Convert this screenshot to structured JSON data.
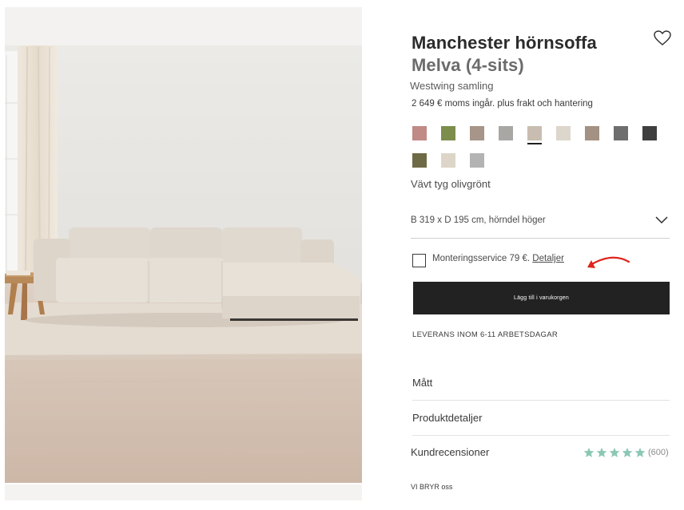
{
  "product": {
    "title_line1": "Manchester hörnsoffa",
    "title_line2": "Melva (4-sits)",
    "collection": "Westwing samling",
    "price": "2 649 € moms ingår. plus frakt och hantering"
  },
  "icons": {
    "wishlist": "heart-icon",
    "size_dropdown": "chevron-down-icon",
    "checkbox": "checkbox-icon",
    "annotation": "red-arrow-icon",
    "rating": "star-icon"
  },
  "swatches": [
    {
      "name": "rose",
      "color": "#c08a86"
    },
    {
      "name": "olive-green",
      "color": "#7d8e4c"
    },
    {
      "name": "taupe",
      "color": "#a69588"
    },
    {
      "name": "light-grey",
      "color": "#a9a7a3"
    },
    {
      "name": "beige",
      "color": "#c8bdb0",
      "selected": true
    },
    {
      "name": "cream",
      "color": "#ddd6cc"
    },
    {
      "name": "mushroom",
      "color": "#a39183"
    },
    {
      "name": "grey",
      "color": "#6e6e6e"
    },
    {
      "name": "anthracite",
      "color": "#3f3f3f"
    },
    {
      "name": "dark-olive",
      "color": "#6e6a45"
    },
    {
      "name": "sand",
      "color": "#ddd5c7"
    },
    {
      "name": "silver-grey",
      "color": "#b3b3b3"
    }
  ],
  "fabric_label": "Vävt tyg olivgrönt",
  "size": {
    "selected": "B 319 x D 195 cm, hörndel höger"
  },
  "mounting": {
    "label": "Monteringsservice 79 €.",
    "link": "Detaljer",
    "checked": false
  },
  "cart_button": "Lägg till i varukorgen",
  "delivery": "LEVERANS INOM 6-11 ARBETSDAGAR",
  "accordion": {
    "measurements": "Mått",
    "details": "Produktdetaljer",
    "reviews": "Kundrecensioner"
  },
  "rating": {
    "stars": 5,
    "count": "(600)",
    "color": "#8cc7b5"
  },
  "care_link": "VI BRYR oss"
}
